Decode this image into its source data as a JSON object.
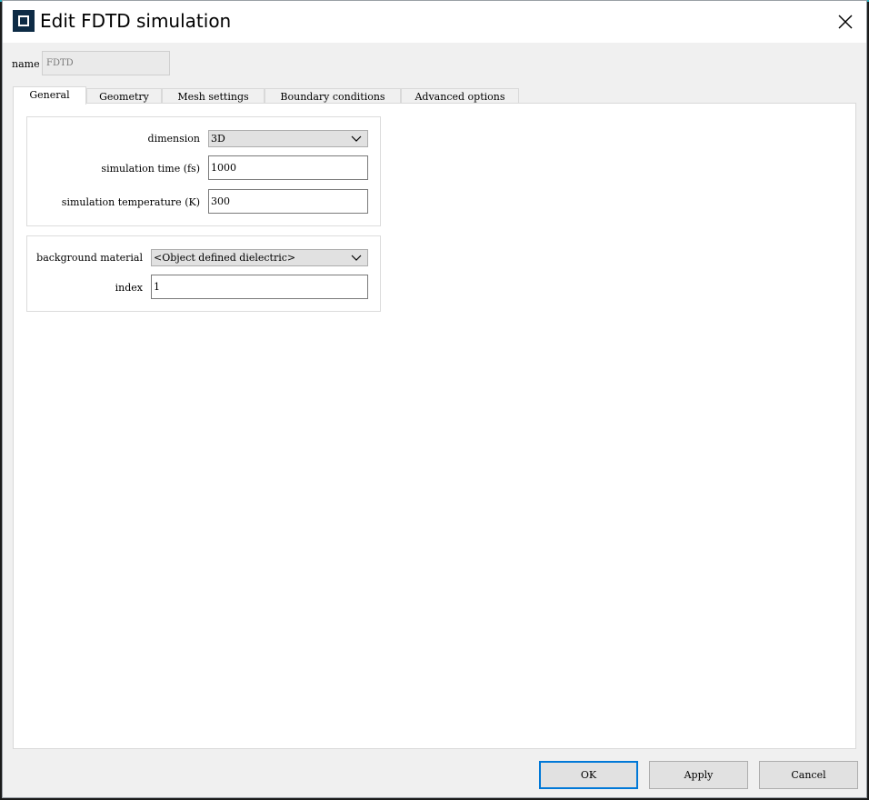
{
  "window": {
    "title": "Edit FDTD simulation"
  },
  "name_field": {
    "label": "name",
    "value": "FDTD"
  },
  "tabs": [
    {
      "label": "General",
      "active": true
    },
    {
      "label": "Geometry",
      "active": false
    },
    {
      "label": "Mesh settings",
      "active": false
    },
    {
      "label": "Boundary conditions",
      "active": false
    },
    {
      "label": "Advanced options",
      "active": false
    }
  ],
  "general": {
    "dimension": {
      "label": "dimension",
      "value": "3D"
    },
    "simulation_time": {
      "label": "simulation time (fs)",
      "value": "1000"
    },
    "simulation_temperature": {
      "label": "simulation temperature (K)",
      "value": "300"
    },
    "background_material": {
      "label": "background material",
      "value": "<Object defined dielectric>"
    },
    "index": {
      "label": "index",
      "value": "1"
    }
  },
  "buttons": {
    "ok": "OK",
    "apply": "Apply",
    "cancel": "Cancel"
  },
  "colors": {
    "accent": "#0078d7",
    "app_icon": "#0d2b45"
  }
}
